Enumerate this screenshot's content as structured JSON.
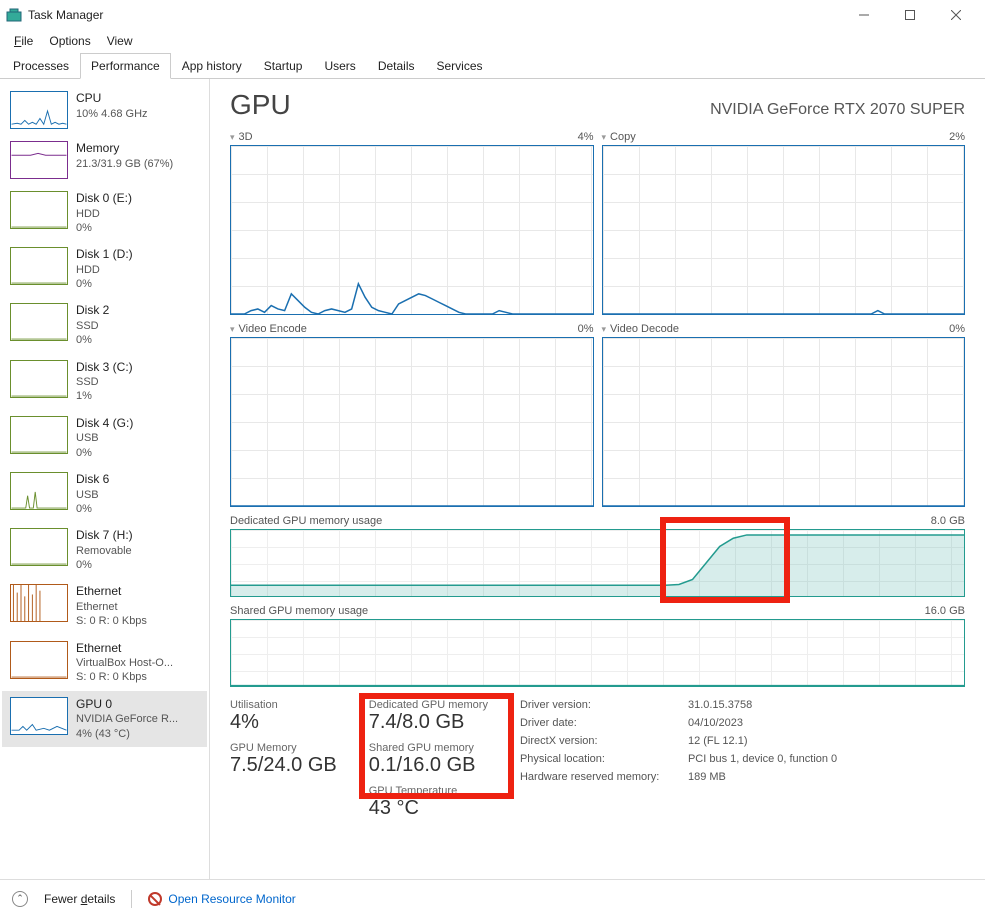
{
  "window": {
    "title": "Task Manager"
  },
  "menubar": {
    "file": "File",
    "options": "Options",
    "view": "View"
  },
  "tabs": {
    "processes": "Processes",
    "performance": "Performance",
    "apphistory": "App history",
    "startup": "Startup",
    "users": "Users",
    "details": "Details",
    "services": "Services"
  },
  "sidebar": [
    {
      "name": "CPU",
      "sub1": "10% 4.68 GHz",
      "sub2": "",
      "color": "#1a6fb0",
      "selected": false,
      "spark": "cpu"
    },
    {
      "name": "Memory",
      "sub1": "21.3/31.9 GB (67%)",
      "sub2": "",
      "color": "#7b2d8e",
      "selected": false,
      "spark": "mem"
    },
    {
      "name": "Disk 0 (E:)",
      "sub1": "HDD",
      "sub2": "0%",
      "color": "#6a8f2d",
      "selected": false,
      "spark": "flat"
    },
    {
      "name": "Disk 1 (D:)",
      "sub1": "HDD",
      "sub2": "0%",
      "color": "#6a8f2d",
      "selected": false,
      "spark": "flat"
    },
    {
      "name": "Disk 2",
      "sub1": "SSD",
      "sub2": "0%",
      "color": "#6a8f2d",
      "selected": false,
      "spark": "flat"
    },
    {
      "name": "Disk 3 (C:)",
      "sub1": "SSD",
      "sub2": "1%",
      "color": "#6a8f2d",
      "selected": false,
      "spark": "flat"
    },
    {
      "name": "Disk 4 (G:)",
      "sub1": "USB",
      "sub2": "0%",
      "color": "#6a8f2d",
      "selected": false,
      "spark": "flat"
    },
    {
      "name": "Disk 6",
      "sub1": "USB",
      "sub2": "0%",
      "color": "#6a8f2d",
      "selected": false,
      "spark": "spike"
    },
    {
      "name": "Disk 7 (H:)",
      "sub1": "Removable",
      "sub2": "0%",
      "color": "#6a8f2d",
      "selected": false,
      "spark": "flat"
    },
    {
      "name": "Ethernet",
      "sub1": "Ethernet",
      "sub2": "S: 0 R: 0 Kbps",
      "color": "#b05a1a",
      "selected": false,
      "spark": "eth"
    },
    {
      "name": "Ethernet",
      "sub1": "VirtualBox Host-O...",
      "sub2": "S: 0 R: 0 Kbps",
      "color": "#b05a1a",
      "selected": false,
      "spark": "flat"
    },
    {
      "name": "GPU 0",
      "sub1": "NVIDIA GeForce R...",
      "sub2": "4% (43 °C)",
      "color": "#1a6fb0",
      "selected": true,
      "spark": "gpu"
    }
  ],
  "main": {
    "title": "GPU",
    "device": "NVIDIA GeForce RTX 2070 SUPER",
    "charts": {
      "threeD": {
        "label": "3D",
        "right": "4%"
      },
      "copy": {
        "label": "Copy",
        "right": "2%"
      },
      "encode": {
        "label": "Video Encode",
        "right": "0%"
      },
      "decode": {
        "label": "Video Decode",
        "right": "0%"
      },
      "dedicated": {
        "label": "Dedicated GPU memory usage",
        "right": "8.0 GB"
      },
      "shared": {
        "label": "Shared GPU memory usage",
        "right": "16.0 GB"
      }
    },
    "stats": {
      "utilisation": {
        "label": "Utilisation",
        "value": "4%"
      },
      "gpumem": {
        "label": "GPU Memory",
        "value": "7.5/24.0 GB"
      },
      "dedicated": {
        "label": "Dedicated GPU memory",
        "value": "7.4/8.0 GB"
      },
      "shared": {
        "label": "Shared GPU memory",
        "value": "0.1/16.0 GB"
      },
      "temp": {
        "label": "GPU Temperature",
        "value": "43 °C"
      }
    },
    "meta": {
      "driverVersionLabel": "Driver version:",
      "driverVersion": "31.0.15.3758",
      "driverDateLabel": "Driver date:",
      "driverDate": "04/10/2023",
      "dxLabel": "DirectX version:",
      "dx": "12 (FL 12.1)",
      "locLabel": "Physical location:",
      "loc": "PCI bus 1, device 0, function 0",
      "hwLabel": "Hardware reserved memory:",
      "hw": "189 MB"
    }
  },
  "footer": {
    "fewer": "Fewer details",
    "resmon": "Open Resource Monitor"
  },
  "chart_data": [
    {
      "type": "line",
      "title": "3D",
      "ylim": [
        0,
        100
      ],
      "values": [
        0,
        0,
        0,
        2,
        3,
        1,
        5,
        3,
        2,
        12,
        8,
        4,
        1,
        0,
        2,
        3,
        2,
        1,
        3,
        18,
        10,
        4,
        2,
        1,
        0,
        6,
        8,
        10,
        12,
        11,
        9,
        7,
        5,
        3,
        1,
        0,
        0,
        0,
        0,
        0,
        2,
        1,
        0,
        0,
        0,
        0,
        0,
        0,
        0,
        0,
        0,
        0,
        0,
        0,
        0
      ]
    },
    {
      "type": "line",
      "title": "Copy",
      "ylim": [
        0,
        100
      ],
      "values": [
        0,
        0,
        0,
        0,
        0,
        0,
        0,
        0,
        0,
        0,
        0,
        0,
        0,
        0,
        0,
        0,
        0,
        0,
        0,
        0,
        0,
        0,
        0,
        0,
        0,
        0,
        0,
        0,
        0,
        0,
        0,
        0,
        0,
        0,
        0,
        0,
        0,
        0,
        0,
        0,
        0,
        2,
        0,
        0,
        0,
        0,
        0,
        0,
        0,
        0,
        0,
        0,
        0,
        0,
        0
      ]
    },
    {
      "type": "line",
      "title": "Video Encode",
      "ylim": [
        0,
        100
      ],
      "values": [
        0,
        0,
        0,
        0,
        0,
        0,
        0,
        0,
        0,
        0,
        0,
        0,
        0,
        0,
        0,
        0,
        0,
        0,
        0,
        0,
        0,
        0,
        0,
        0,
        0,
        0,
        0,
        0,
        0,
        0,
        0,
        0,
        0,
        0,
        0,
        0,
        0,
        0,
        0,
        0,
        0,
        0,
        0,
        0,
        0,
        0,
        0,
        0,
        0,
        0,
        0,
        0,
        0,
        0,
        0
      ]
    },
    {
      "type": "line",
      "title": "Video Decode",
      "ylim": [
        0,
        100
      ],
      "values": [
        0,
        0,
        0,
        0,
        0,
        0,
        0,
        0,
        0,
        0,
        0,
        0,
        0,
        0,
        0,
        0,
        0,
        0,
        0,
        0,
        0,
        0,
        0,
        0,
        0,
        0,
        0,
        0,
        0,
        0,
        0,
        0,
        0,
        0,
        0,
        0,
        0,
        0,
        0,
        0,
        0,
        0,
        0,
        0,
        0,
        0,
        0,
        0,
        0,
        0,
        0,
        0,
        0,
        0,
        0
      ]
    },
    {
      "type": "area",
      "title": "Dedicated GPU memory usage",
      "ylim": [
        0,
        8.0
      ],
      "values": [
        1.3,
        1.3,
        1.3,
        1.3,
        1.3,
        1.3,
        1.3,
        1.3,
        1.3,
        1.3,
        1.3,
        1.3,
        1.3,
        1.3,
        1.3,
        1.3,
        1.3,
        1.3,
        1.3,
        1.3,
        1.3,
        1.3,
        1.3,
        1.3,
        1.3,
        1.3,
        1.3,
        1.3,
        1.3,
        1.3,
        1.3,
        1.3,
        1.3,
        1.4,
        2.0,
        4.0,
        6.0,
        7.0,
        7.4,
        7.4,
        7.4,
        7.4,
        7.4,
        7.4,
        7.4,
        7.4,
        7.4,
        7.4,
        7.4,
        7.4,
        7.4,
        7.4,
        7.4,
        7.4,
        7.4
      ]
    },
    {
      "type": "area",
      "title": "Shared GPU memory usage",
      "ylim": [
        0,
        16.0
      ],
      "values": [
        0.1,
        0.1,
        0.1,
        0.1,
        0.1,
        0.1,
        0.1,
        0.1,
        0.1,
        0.1,
        0.1,
        0.1,
        0.1,
        0.1,
        0.1,
        0.1,
        0.1,
        0.1,
        0.1,
        0.1,
        0.1,
        0.1,
        0.1,
        0.1,
        0.1,
        0.1,
        0.1,
        0.1,
        0.1,
        0.1,
        0.1,
        0.1,
        0.1,
        0.1,
        0.1,
        0.1,
        0.1,
        0.1,
        0.1,
        0.1,
        0.1,
        0.1,
        0.1,
        0.1,
        0.1,
        0.1,
        0.1,
        0.1,
        0.1,
        0.1,
        0.1,
        0.1,
        0.1,
        0.1,
        0.1
      ]
    }
  ]
}
